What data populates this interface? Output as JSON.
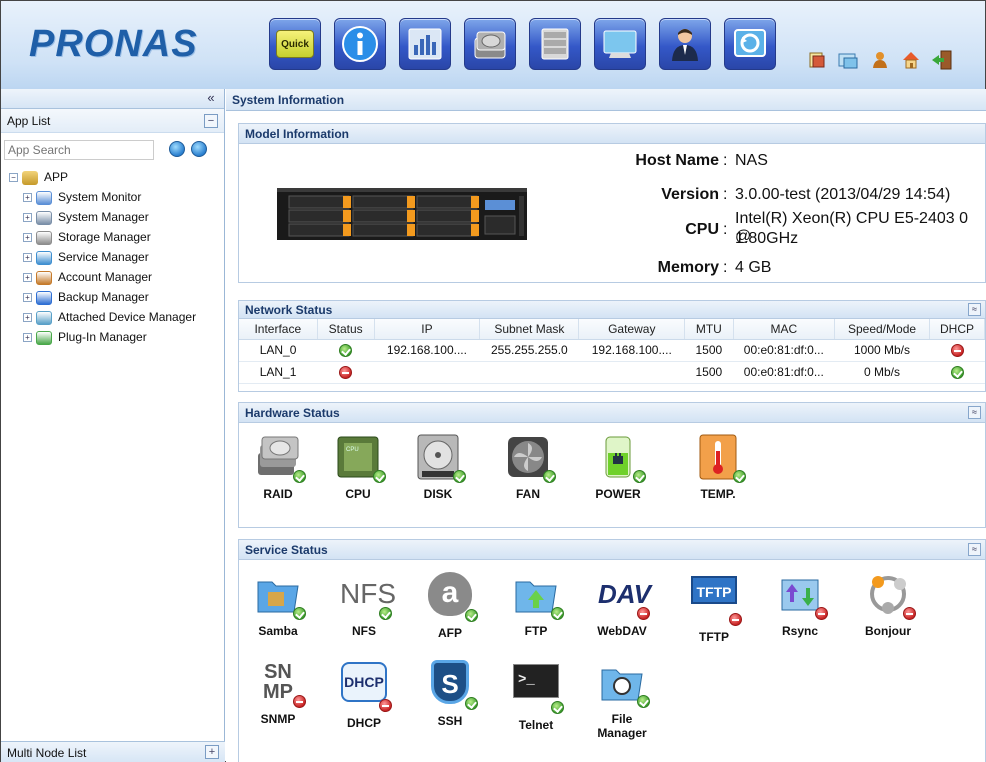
{
  "header": {
    "logo": "PRONAS",
    "toolbar": [
      {
        "name": "quick-wizard",
        "label": "Quick"
      },
      {
        "name": "info"
      },
      {
        "name": "system-monitor"
      },
      {
        "name": "storage"
      },
      {
        "name": "service"
      },
      {
        "name": "attached-device"
      },
      {
        "name": "account"
      },
      {
        "name": "backup"
      }
    ],
    "small_icons": [
      "language",
      "file-browser",
      "user",
      "home",
      "logout"
    ]
  },
  "left": {
    "collapse_glyph": "«",
    "app_list_label": "App List",
    "collapse_btn": "−",
    "search": {
      "placeholder": "App Search"
    },
    "tree_root": "APP",
    "items": [
      {
        "label": "System Monitor",
        "color": "#5b8fd6"
      },
      {
        "label": "System Manager",
        "color": "#7a8fa8"
      },
      {
        "label": "Storage Manager",
        "color": "#8d8d8d"
      },
      {
        "label": "Service Manager",
        "color": "#3f8fd0"
      },
      {
        "label": "Account Manager",
        "color": "#c57a2b"
      },
      {
        "label": "Backup Manager",
        "color": "#2f6fd3"
      },
      {
        "label": "Attached Device Manager",
        "color": "#5aa0c8"
      },
      {
        "label": "Plug-In Manager",
        "color": "#4aa84a"
      }
    ],
    "multi_node_label": "Multi Node List",
    "multi_node_btn": "+"
  },
  "main": {
    "title": "System Information",
    "model": {
      "heading": "Model Information",
      "host_key": "Host Name",
      "host_val": "NAS",
      "version_key": "Version",
      "version_val": "3.0.00-test (2013/04/29 14:54)",
      "cpu_key": "CPU",
      "cpu_val_1": "Intel(R) Xeon(R) CPU E5-2403 0 @",
      "cpu_val_2": "1.80GHz",
      "memory_key": "Memory",
      "memory_val": "4 GB",
      "sep": ":"
    },
    "network": {
      "heading": "Network Status",
      "columns": [
        "Interface",
        "Status",
        "IP",
        "Subnet Mask",
        "Gateway",
        "MTU",
        "MAC",
        "Speed/Mode",
        "DHCP"
      ],
      "rows": [
        {
          "iface": "LAN_0",
          "status": "ok",
          "ip": "192.168.100....",
          "mask": "255.255.255.0",
          "gw": "192.168.100....",
          "mtu": "1500",
          "mac": "00:e0:81:df:0...",
          "speed": "1000 Mb/s",
          "dhcp": "no"
        },
        {
          "iface": "LAN_1",
          "status": "no",
          "ip": "",
          "mask": "",
          "gw": "",
          "mtu": "1500",
          "mac": "00:e0:81:df:0...",
          "speed": "0 Mb/s",
          "dhcp": "ok"
        }
      ]
    },
    "hardware": {
      "heading": "Hardware Status",
      "items": [
        {
          "label": "RAID",
          "status": "ok"
        },
        {
          "label": "CPU",
          "status": "ok"
        },
        {
          "label": "DISK",
          "status": "ok"
        },
        {
          "label": "FAN",
          "status": "ok"
        },
        {
          "label": "POWER",
          "status": "ok"
        },
        {
          "label": "TEMP.",
          "status": "ok"
        }
      ]
    },
    "service": {
      "heading": "Service Status",
      "items": [
        {
          "label": "Samba",
          "status": "ok"
        },
        {
          "label": "NFS",
          "status": "ok"
        },
        {
          "label": "AFP",
          "status": "ok"
        },
        {
          "label": "FTP",
          "status": "ok"
        },
        {
          "label": "WebDAV",
          "status": "no"
        },
        {
          "label": "TFTP",
          "status": "no"
        },
        {
          "label": "Rsync",
          "status": "no"
        },
        {
          "label": "Bonjour",
          "status": "no"
        },
        {
          "label": "SNMP",
          "status": "no"
        },
        {
          "label": "DHCP",
          "status": "no"
        },
        {
          "label": "SSH",
          "status": "ok"
        },
        {
          "label": "Telnet",
          "status": "ok"
        },
        {
          "label": "File Manager",
          "status": "ok"
        }
      ],
      "icon_text": {
        "nfs": "NFS",
        "dav": "DAV",
        "tftp": "TFTP",
        "snmp_1": "SN",
        "snmp_2": "MP",
        "dhcp": "DHCP",
        "ssh": "S",
        "telnet": ">_",
        "afp": "a"
      }
    },
    "collapse_glyph": "≈"
  }
}
